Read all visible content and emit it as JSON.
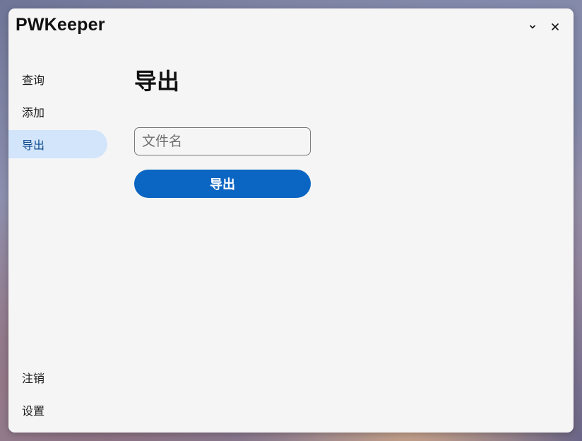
{
  "app": {
    "title": "PWKeeper"
  },
  "titlebar": {
    "minimize_icon": "chevron-down-icon",
    "close_icon": "close-icon"
  },
  "sidebar": {
    "items": [
      {
        "label": "查询",
        "active": false
      },
      {
        "label": "添加",
        "active": false
      },
      {
        "label": "导出",
        "active": true
      }
    ],
    "bottom_items": [
      {
        "label": "注销"
      },
      {
        "label": "设置"
      }
    ]
  },
  "main": {
    "title": "导出",
    "filename_input": {
      "value": "",
      "placeholder": "文件名"
    },
    "export_button": {
      "label": "导出"
    }
  },
  "colors": {
    "window_bg": "#f5f5f5",
    "accent": "#0b65c2",
    "nav_active_bg": "#d3e5fb",
    "nav_active_text": "#0d4a8f"
  }
}
